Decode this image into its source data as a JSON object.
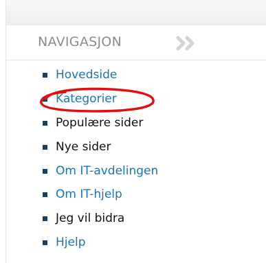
{
  "navigation": {
    "heading": "NAVIGASJON",
    "heading_icon": "double-chevron-right-icon",
    "items": [
      {
        "label": "Hovedside",
        "style": "blue"
      },
      {
        "label": "Kategorier",
        "style": "blue"
      },
      {
        "label": "Populære sider",
        "style": "black"
      },
      {
        "label": "Nye sider",
        "style": "black"
      },
      {
        "label": "Om IT-avdelingen",
        "style": "blue"
      },
      {
        "label": "Om IT-hjelp",
        "style": "blue"
      },
      {
        "label": "Jeg vil bidra",
        "style": "black"
      },
      {
        "label": "Hjelp",
        "style": "blue"
      }
    ]
  },
  "colors": {
    "link_blue": "#1b73b8",
    "text_black": "#111111",
    "bullet": "#1d3f5e",
    "heading_gray": "#8c8c8c",
    "annotation_red": "#e01010"
  }
}
